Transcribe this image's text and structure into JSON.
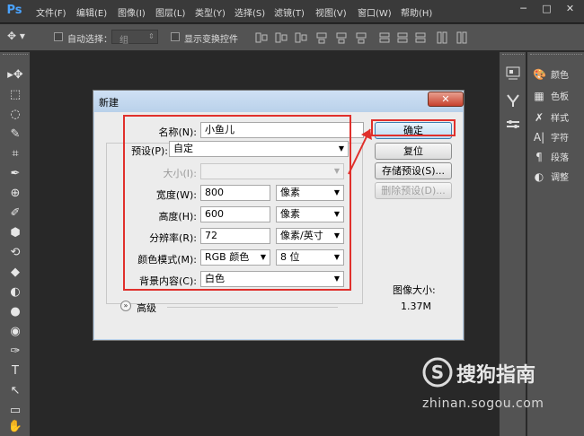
{
  "app": {
    "logo": "Ps"
  },
  "menu": [
    "文件(F)",
    "编辑(E)",
    "图像(I)",
    "图层(L)",
    "类型(Y)",
    "选择(S)",
    "滤镜(T)",
    "视图(V)",
    "窗口(W)",
    "帮助(H)"
  ],
  "window_controls": {
    "minimize": "─",
    "maximize": "□",
    "close": "✕"
  },
  "options_bar": {
    "auto_select_label": "自动选择：",
    "auto_select_value": "组",
    "show_transform_label": "显示变换控件"
  },
  "tools": [
    "▸✥",
    "⬚",
    "◌",
    "✎",
    "⌗",
    "✒",
    "⊕",
    "✐",
    "⬢",
    "⟲",
    "◆",
    "◐",
    "●",
    "◉",
    "✑",
    "T",
    "↖",
    "▭",
    "✋",
    "🔍"
  ],
  "panels": {
    "items": [
      {
        "icon": "palette-icon",
        "label": "颜色"
      },
      {
        "icon": "swatches-icon",
        "label": "色板"
      },
      {
        "icon": "styles-icon",
        "label": "样式"
      },
      {
        "icon": "character-icon",
        "label": "字符"
      },
      {
        "icon": "paragraph-icon",
        "label": "段落"
      },
      {
        "icon": "adjustments-icon",
        "label": "调整"
      }
    ]
  },
  "dialog": {
    "title": "新建",
    "close": "✕",
    "fields": {
      "name": {
        "label": "名称(N):",
        "value": "小鱼儿"
      },
      "preset": {
        "label": "预设(P):",
        "value": "自定"
      },
      "size": {
        "label": "大小(I):",
        "value": ""
      },
      "width": {
        "label": "宽度(W):",
        "value": "800",
        "unit": "像素"
      },
      "height": {
        "label": "高度(H):",
        "value": "600",
        "unit": "像素"
      },
      "resolution": {
        "label": "分辨率(R):",
        "value": "72",
        "unit": "像素/英寸"
      },
      "color_mode": {
        "label": "颜色模式(M):",
        "value": "RGB 颜色",
        "depth": "8 位"
      },
      "background": {
        "label": "背景内容(C):",
        "value": "白色"
      }
    },
    "advanced": "高级",
    "buttons": {
      "ok": "确定",
      "reset": "复位",
      "save_preset": "存储预设(S)...",
      "delete_preset": "删除预设(D)..."
    },
    "image_size_label": "图像大小:",
    "image_size_value": "1.37M"
  },
  "watermark": {
    "brand": "搜狗指南",
    "url": "zhinan.sogou.com"
  },
  "colors": {
    "highlight": "#e0302c",
    "ps_blue": "#4aa3ff"
  }
}
